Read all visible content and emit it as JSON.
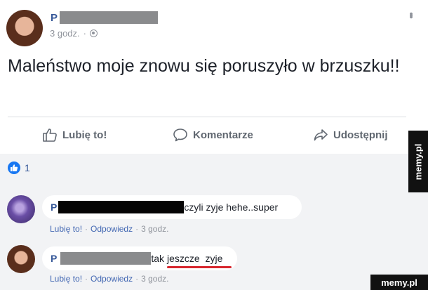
{
  "post": {
    "author_initial": "P",
    "time": "3 godz.",
    "separator": "·",
    "menu_glyph": "•••",
    "text": "Maleństwo moje znowu się poruszyło w brzuszku!!",
    "actions": {
      "like": "Lubię to!",
      "comment": "Komentarze",
      "share": "Udostępnij"
    },
    "reactions": {
      "icon": "thumbs-up-icon",
      "count": "1"
    }
  },
  "comments": [
    {
      "author_initial": "P",
      "text": "czyli zyje hehe..super",
      "like": "Lubię to!",
      "reply": "Odpowiedz",
      "time": "3 godz.",
      "sep": "·"
    },
    {
      "author_initial": "P",
      "text_prefix": "tak",
      "text_highlight": "jeszcze  zyje",
      "like": "Lubię to!",
      "reply": "Odpowiedz",
      "time": "3 godz.",
      "sep": "·"
    }
  ],
  "watermark": {
    "side": "memy.pl",
    "corner": "memy.pl"
  },
  "colors": {
    "link": "#365899",
    "muted": "#90949c",
    "accent_blue": "#1877f2",
    "highlight_red": "#d7262e"
  }
}
